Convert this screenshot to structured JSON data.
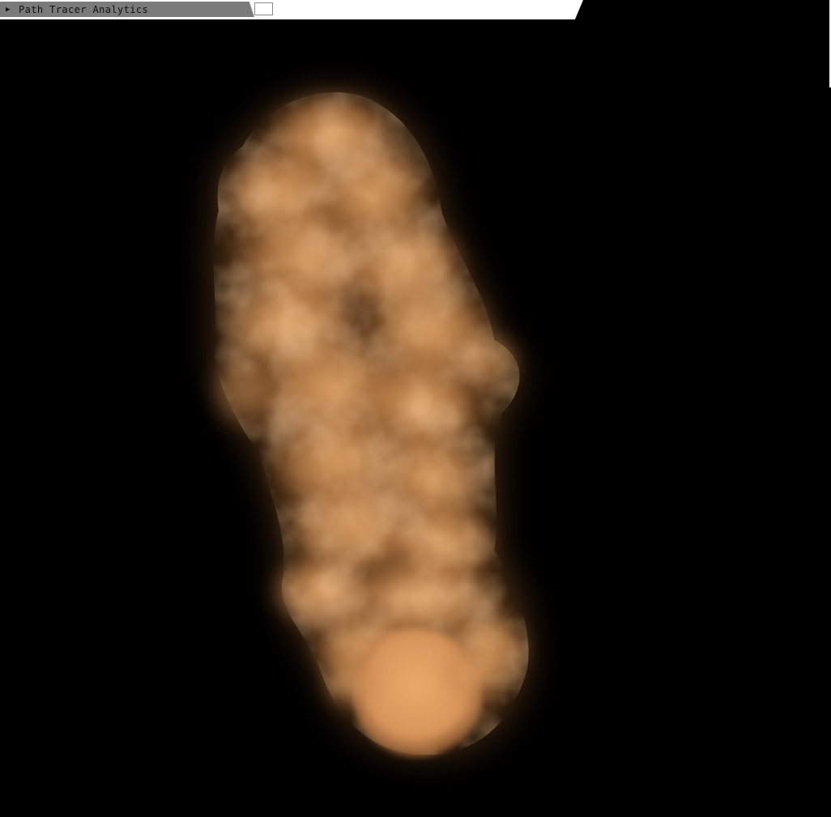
{
  "window": {
    "title": "Path Tracer Analytics",
    "collapsed": true,
    "arrow_icon": "collapse-arrow-right-icon"
  },
  "scene": {
    "background_color": "#000000",
    "smoke_color": "#d99a5e",
    "smoke_highlight": "#f0b77a",
    "smoke_shadow": "#6b3f1e"
  }
}
